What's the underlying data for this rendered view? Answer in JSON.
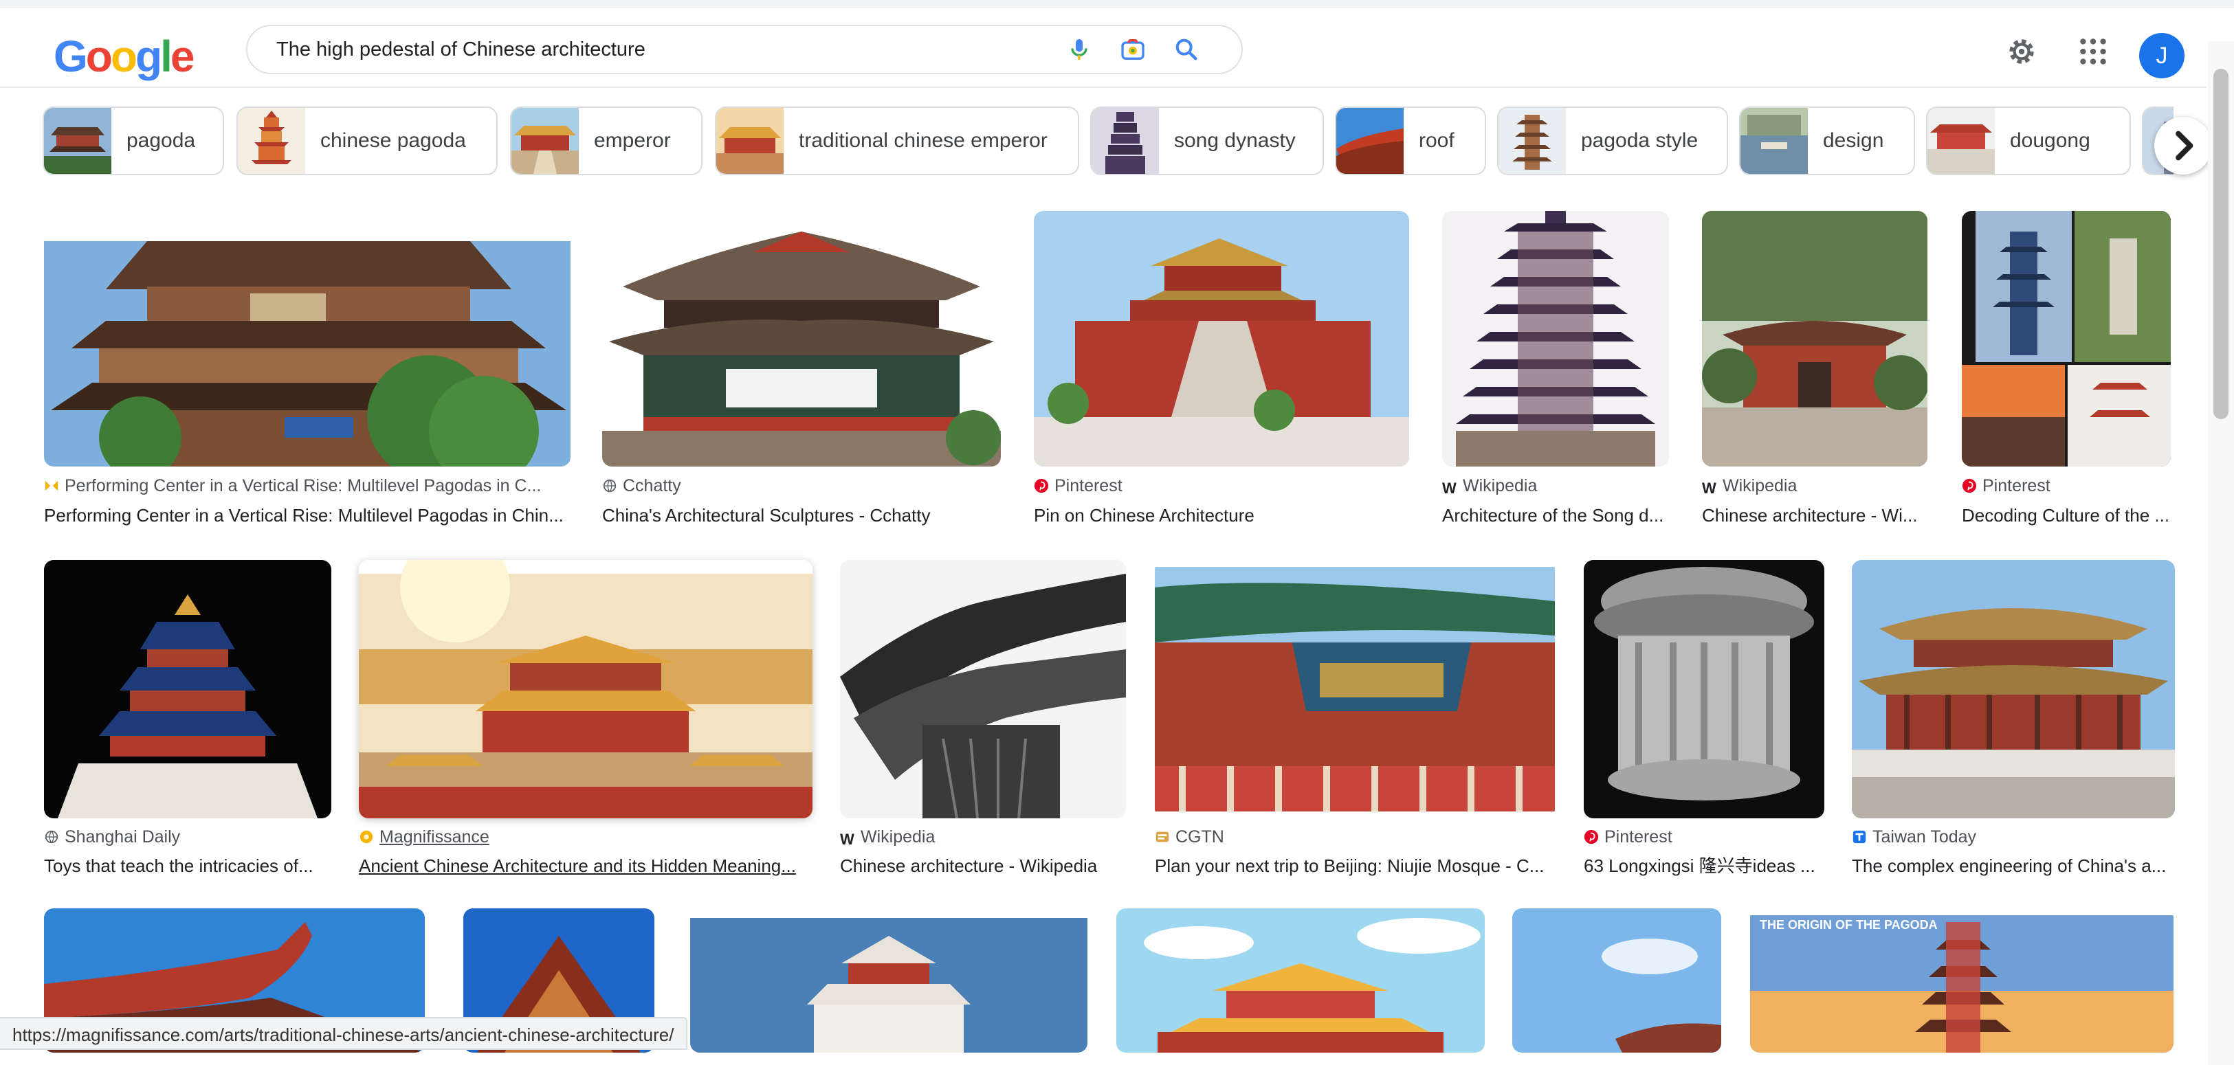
{
  "header": {
    "logo_letters": [
      {
        "ch": "G",
        "color": "#4285f4"
      },
      {
        "ch": "o",
        "color": "#ea4335"
      },
      {
        "ch": "o",
        "color": "#fbbc05"
      },
      {
        "ch": "g",
        "color": "#4285f4"
      },
      {
        "ch": "l",
        "color": "#34a853"
      },
      {
        "ch": "e",
        "color": "#ea4335"
      }
    ],
    "search_query": "The high pedestal of Chinese architecture",
    "avatar_letter": "J"
  },
  "chips": [
    {
      "label": "pagoda"
    },
    {
      "label": "chinese pagoda"
    },
    {
      "label": "emperor"
    },
    {
      "label": "traditional chinese emperor"
    },
    {
      "label": "song dynasty"
    },
    {
      "label": "roof"
    },
    {
      "label": "pagoda style"
    },
    {
      "label": "design"
    },
    {
      "label": "dougong"
    }
  ],
  "results": {
    "row1": [
      {
        "source": "Performing Center in a Vertical Rise: Multilevel Pagodas in C...",
        "title": "Performing Center in a Vertical Rise: Multilevel Pagodas in Chin...",
        "source_icon": "magnifying-glass-icon"
      },
      {
        "source": "Cchatty",
        "title": "China's Architectural Sculptures - Cchatty",
        "source_icon": "globe-icon"
      },
      {
        "source": "Pinterest",
        "title": "Pin on Chinese Architecture",
        "source_icon": "pinterest-icon"
      },
      {
        "source": "Wikipedia",
        "title": "Architecture of the Song d...",
        "source_icon": "wikipedia-icon"
      },
      {
        "source": "Wikipedia",
        "title": "Chinese architecture - Wi...",
        "source_icon": "wikipedia-icon"
      },
      {
        "source": "Pinterest",
        "title": "Decoding Culture of the ...",
        "source_icon": "pinterest-icon"
      }
    ],
    "row2": [
      {
        "source": "Shanghai Daily",
        "title": "Toys that teach the intricacies of...",
        "source_icon": "globe-icon"
      },
      {
        "source": "Magnifissance",
        "title": "Ancient Chinese Architecture and its Hidden Meaning...",
        "source_icon": "magnifissance-icon"
      },
      {
        "source": "Wikipedia",
        "title": "Chinese architecture - Wikipedia",
        "source_icon": "wikipedia-icon"
      },
      {
        "source": "CGTN",
        "title": "Plan your next trip to Beijing: Niujie Mosque - C...",
        "source_icon": "cgtn-icon"
      },
      {
        "source": "Pinterest",
        "title": "63 Longxingsi 隆兴寺ideas ...",
        "source_icon": "pinterest-icon"
      },
      {
        "source": "Taiwan Today",
        "title": "The complex engineering of China's a...",
        "source_icon": "taiwan-today-icon"
      }
    ],
    "row3_caption": "THE ORIGIN OF THE PAGODA"
  },
  "status_bar": {
    "url": "https://magnifissance.com/arts/traditional-chinese-arts/ancient-chinese-architecture/"
  },
  "colors": {
    "accent": "#1a73e8",
    "pinterest": "#e60023",
    "temple_red": "#b33a2a",
    "roof_gold": "#d9a441",
    "sky": "#9ecbf0"
  }
}
